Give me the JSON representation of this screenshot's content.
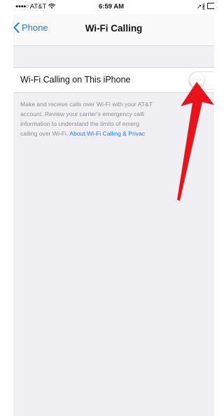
{
  "status_bar": {
    "carrier": "AT&T",
    "time": "6:59 AM"
  },
  "nav": {
    "back_label": "Phone",
    "title": "Wi-Fi Calling"
  },
  "setting": {
    "label": "Wi-Fi Calling on This iPhone",
    "enabled": false
  },
  "footer": {
    "lines": [
      "Make and receive calls over Wi-Fi with your AT&T",
      "account. Review your carrier's emergency calli",
      "information to understand the limits of emerg",
      "calling over Wi-Fi."
    ],
    "link": "About Wi-Fi Calling & Privac"
  },
  "colors": {
    "accent": "#1a7cf2",
    "annotation_arrow": "#e8141b"
  },
  "icons": [
    "signal-dots-icon",
    "wifi-icon",
    "chevron-left-icon",
    "location-icon",
    "bluetooth-icon",
    "battery-icon",
    "annotation-arrow"
  ]
}
